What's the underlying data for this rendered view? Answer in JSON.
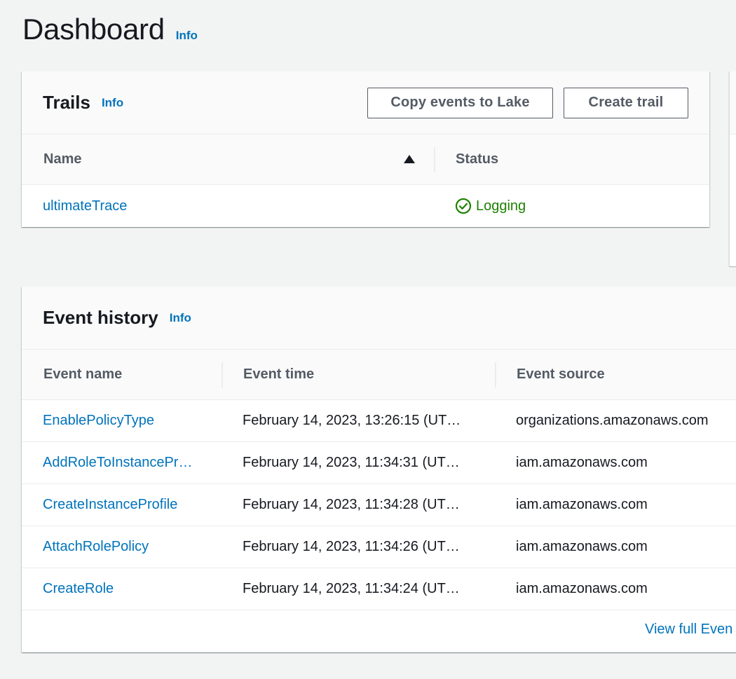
{
  "page": {
    "title": "Dashboard",
    "info": "Info"
  },
  "trails": {
    "title": "Trails",
    "info": "Info",
    "copy_button": "Copy events to Lake",
    "create_button": "Create trail",
    "columns": {
      "name": "Name",
      "status": "Status"
    },
    "rows": [
      {
        "name": "ultimateTrace",
        "status": "Logging"
      }
    ]
  },
  "event_history": {
    "title": "Event history",
    "info": "Info",
    "columns": {
      "event_name": "Event name",
      "event_time": "Event time",
      "event_source": "Event source"
    },
    "rows": [
      {
        "name": "EnablePolicyType",
        "time": "February 14, 2023, 13:26:15 (UT…",
        "source": "organizations.amazonaws.com"
      },
      {
        "name": "AddRoleToInstancePr…",
        "time": "February 14, 2023, 11:34:31 (UT…",
        "source": "iam.amazonaws.com"
      },
      {
        "name": "CreateInstanceProfile",
        "time": "February 14, 2023, 11:34:28 (UT…",
        "source": "iam.amazonaws.com"
      },
      {
        "name": "AttachRolePolicy",
        "time": "February 14, 2023, 11:34:26 (UT…",
        "source": "iam.amazonaws.com"
      },
      {
        "name": "CreateRole",
        "time": "February 14, 2023, 11:34:24 (UT…",
        "source": "iam.amazonaws.com"
      }
    ],
    "footer_link": "View full Even"
  },
  "colors": {
    "link": "#0073bb",
    "success": "#1d8102",
    "background": "#f2f3f3"
  },
  "icons": {
    "sort": "sort-ascending-icon",
    "status": "check-circle-icon"
  }
}
